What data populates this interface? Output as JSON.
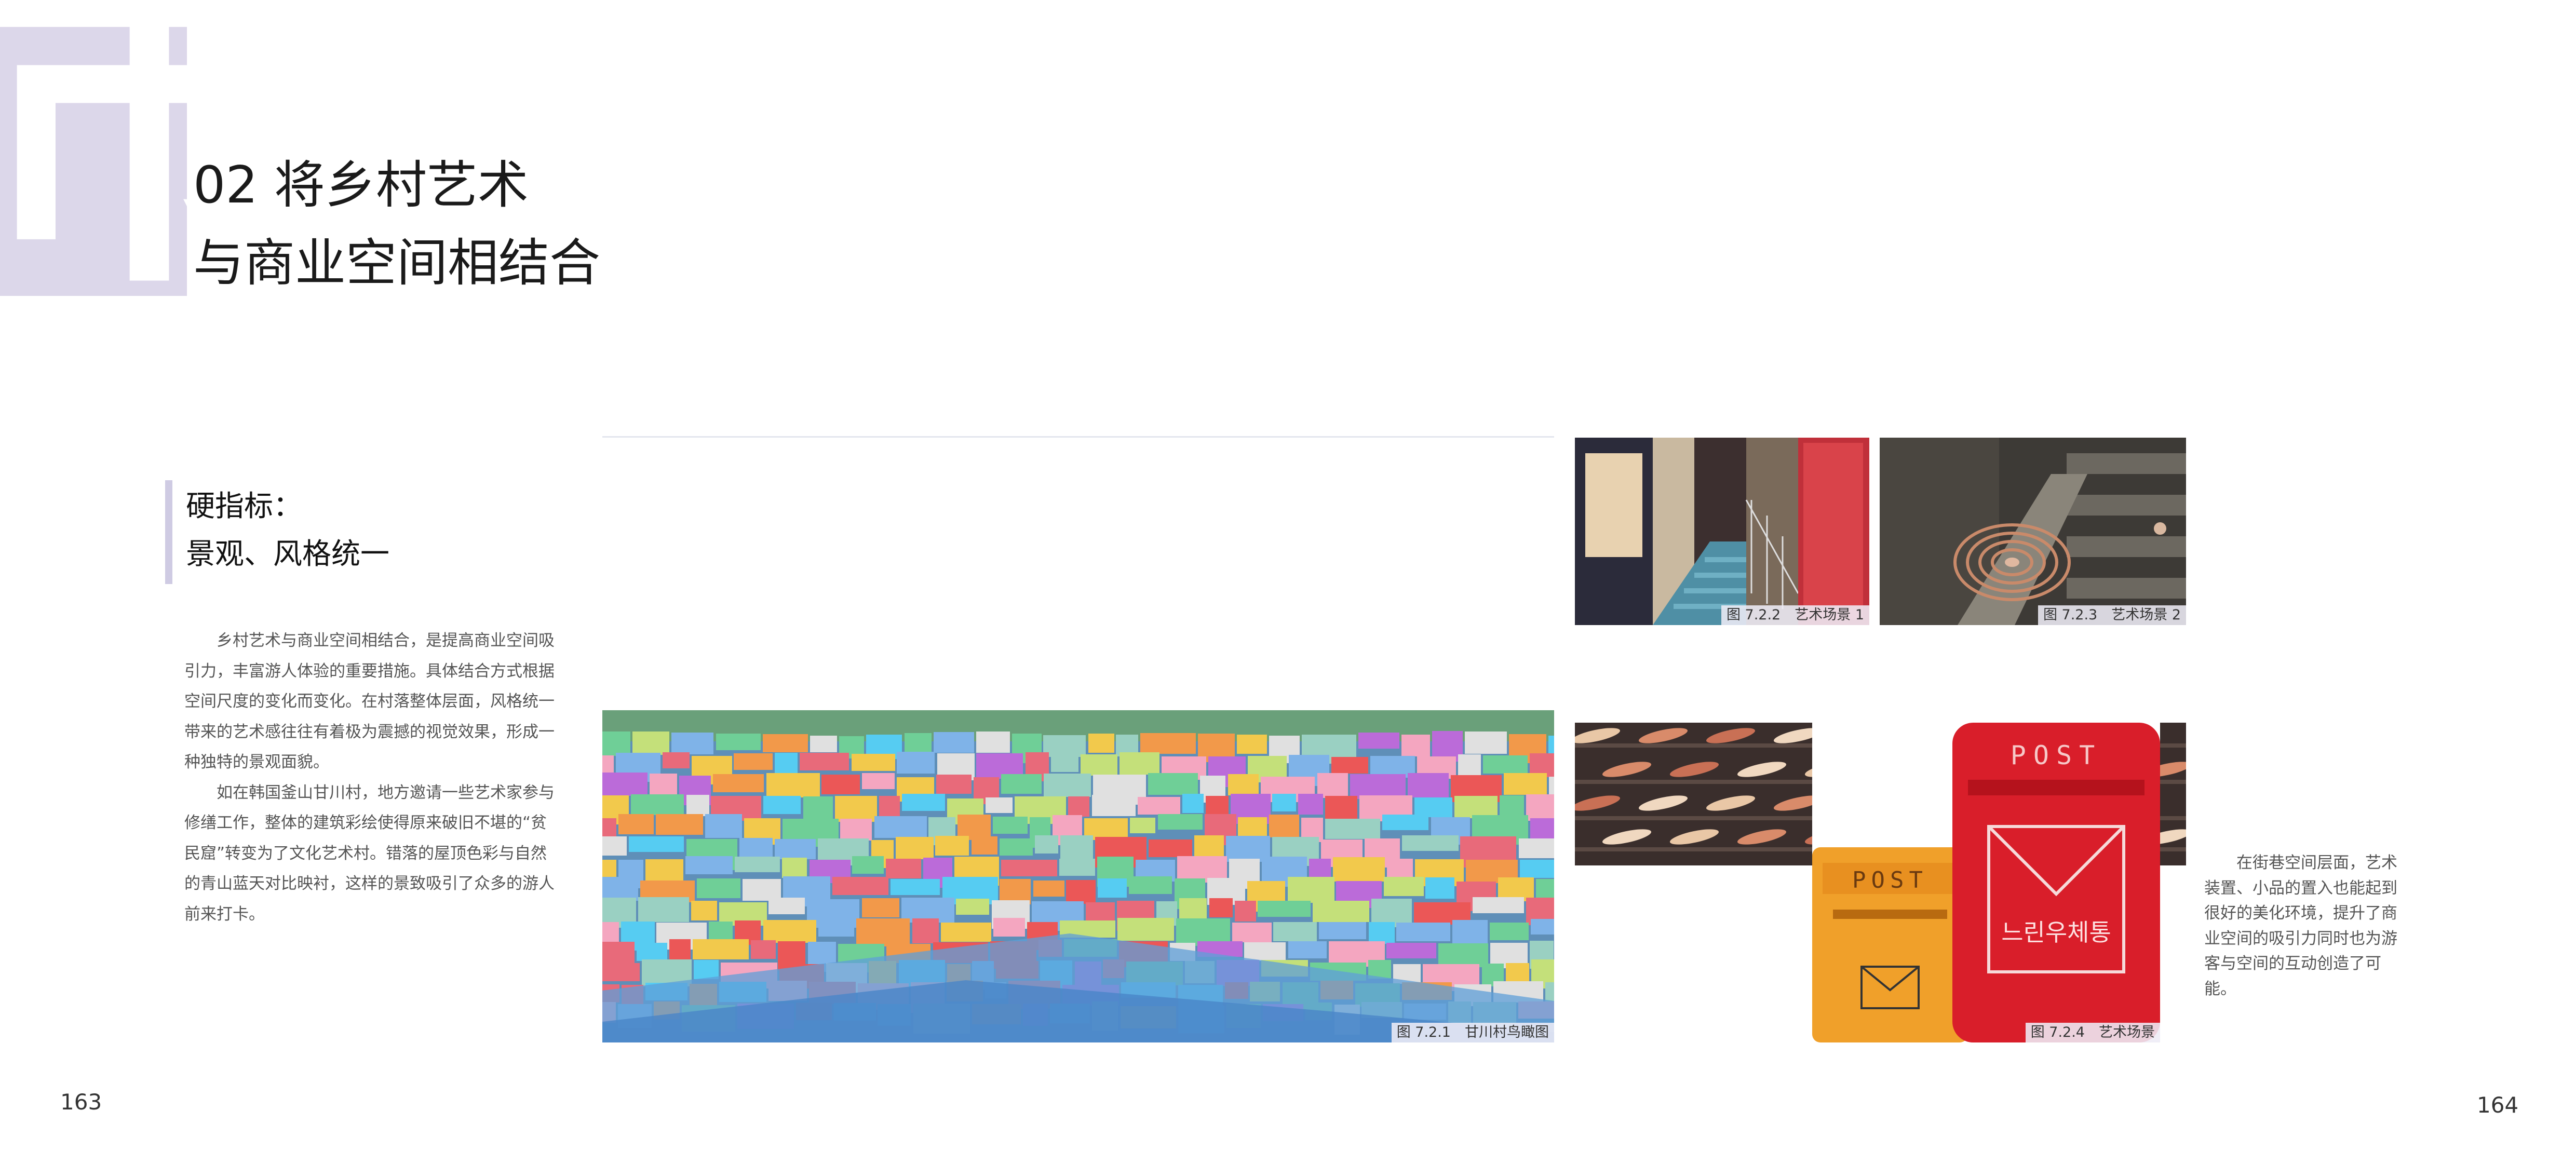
{
  "decor": {
    "glyph": "市"
  },
  "title": {
    "line1": "02 将乡村艺术",
    "line2": "与商业空间相结合"
  },
  "subhead": {
    "line1": "硬指标：",
    "line2": "景观、风格统一"
  },
  "body_left": [
    "乡村艺术与商业空间相结合，是提高商业空间吸引力，丰富游人体验的重要措施。具体结合方式根据空间尺度的变化而变化。在村落整体层面，风格统一带来的艺术感往往有着极为震撼的视觉效果，形成一种独特的景观面貌。",
    "如在韩国釜山甘川村，地方邀请一些艺术家参与修缮工作，整体的建筑彩绘使得原来破旧不堪的“贫民窟”转变为了文化艺术村。错落的屋顶色彩与自然的青山蓝天对比映衬，这样的景致吸引了众多的游人前来打卡。"
  ],
  "body_right": "在街巷空间层面，艺术装置、小品的置入也能起到很好的美化环境，提升了商业空间的吸引力同时也为游客与空间的互动创造了可能。",
  "figures": {
    "f721": {
      "caption": "图 7.2.1　甘川村鸟瞰图",
      "alt": "village-aerial"
    },
    "f722": {
      "caption": "图 7.2.2　艺术场景 1",
      "alt": "alley-stairs"
    },
    "f723": {
      "caption": "图 7.2.3　艺术场景 2",
      "alt": "spiral-sculpture"
    },
    "f724": {
      "caption": "图 7.2.4　艺术场景",
      "alt": "post-boxes",
      "post_text": "POST",
      "korean_text": "느린우체통"
    }
  },
  "page_numbers": {
    "left": "163",
    "right": "164"
  },
  "colors": {
    "accent": "#cfcbe3",
    "decor_bg": "#dcd7ea",
    "caption_bg": "#eeecf6"
  }
}
